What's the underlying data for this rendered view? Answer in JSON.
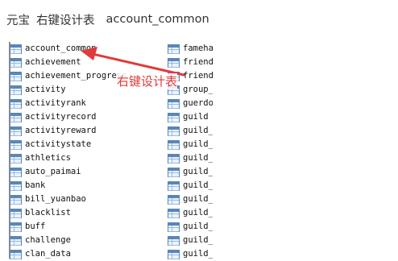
{
  "header": {
    "part1": "元宝",
    "part2": "右键设计表",
    "part3": "account_common"
  },
  "annotation": {
    "text": "右键设计表",
    "color": "#e03a3a"
  },
  "tables_left": [
    "account_common",
    "achievement",
    "achievement_progress",
    "activity",
    "activityrank",
    "activityrecord",
    "activityreward",
    "activitystate",
    "athletics",
    "auto_paimai",
    "bank",
    "bill_yuanbao",
    "blacklist",
    "buff",
    "challenge",
    "clan_data"
  ],
  "tables_right": [
    "fameha",
    "friend",
    "friend",
    "group_",
    "guerdo",
    "guild",
    "guild_",
    "guild_",
    "guild_",
    "guild_",
    "guild_",
    "guild_",
    "guild_",
    "guild_",
    "guild_",
    "guild_"
  ],
  "icons": {
    "table": "table-icon"
  }
}
